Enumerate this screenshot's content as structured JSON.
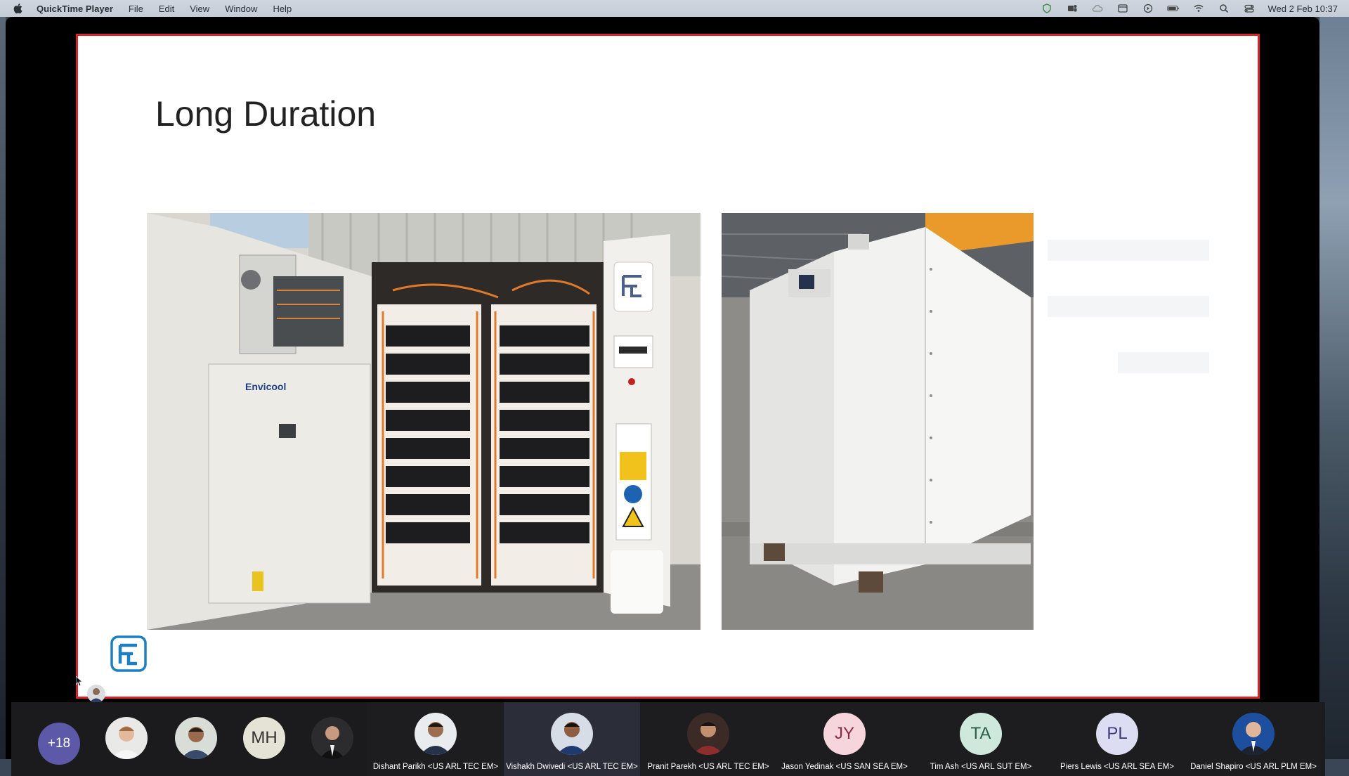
{
  "menubar": {
    "app_name": "QuickTime Player",
    "menus": [
      "File",
      "Edit",
      "View",
      "Window",
      "Help"
    ],
    "status_icons": [
      "shield-icon",
      "teams-icon",
      "cloud-icon",
      "calendar-icon",
      "play-icon",
      "battery-icon",
      "wifi-icon",
      "search-icon",
      "control-center-icon"
    ],
    "clock": "Wed 2 Feb  10:37"
  },
  "slide": {
    "title": "Long Duration",
    "left_photo_caption_logo": "Envicool"
  },
  "participants": {
    "overflow_count": "+18",
    "small": [
      {
        "kind": "photo"
      },
      {
        "kind": "photo"
      },
      {
        "kind": "initials",
        "initials": "MH"
      },
      {
        "kind": "photo"
      }
    ],
    "tiles": [
      {
        "name": "Dishant Parikh <US ARL TEC EM>",
        "kind": "photo"
      },
      {
        "name": "Vishakh Dwivedi <US ARL TEC EM>",
        "kind": "photo",
        "active": true
      },
      {
        "name": "Pranit Parekh  <US ARL TEC EM>",
        "kind": "photo"
      },
      {
        "name": "Jason Yedinak <US SAN SEA EM>",
        "kind": "initials",
        "initials": "JY",
        "color": "#f6d5dc"
      },
      {
        "name": "Tim Ash <US ARL SUT EM>",
        "kind": "initials",
        "initials": "TA",
        "color": "#cfe8dc"
      },
      {
        "name": "Piers Lewis <US ARL SEA EM>",
        "kind": "initials",
        "initials": "PL",
        "color": "#dcdcf2"
      },
      {
        "name": "Daniel Shapiro <US ARL PLM EM>",
        "kind": "photo"
      }
    ]
  },
  "colors": {
    "slide_border": "#d9242b",
    "brand_blue": "#1b7fc2"
  }
}
